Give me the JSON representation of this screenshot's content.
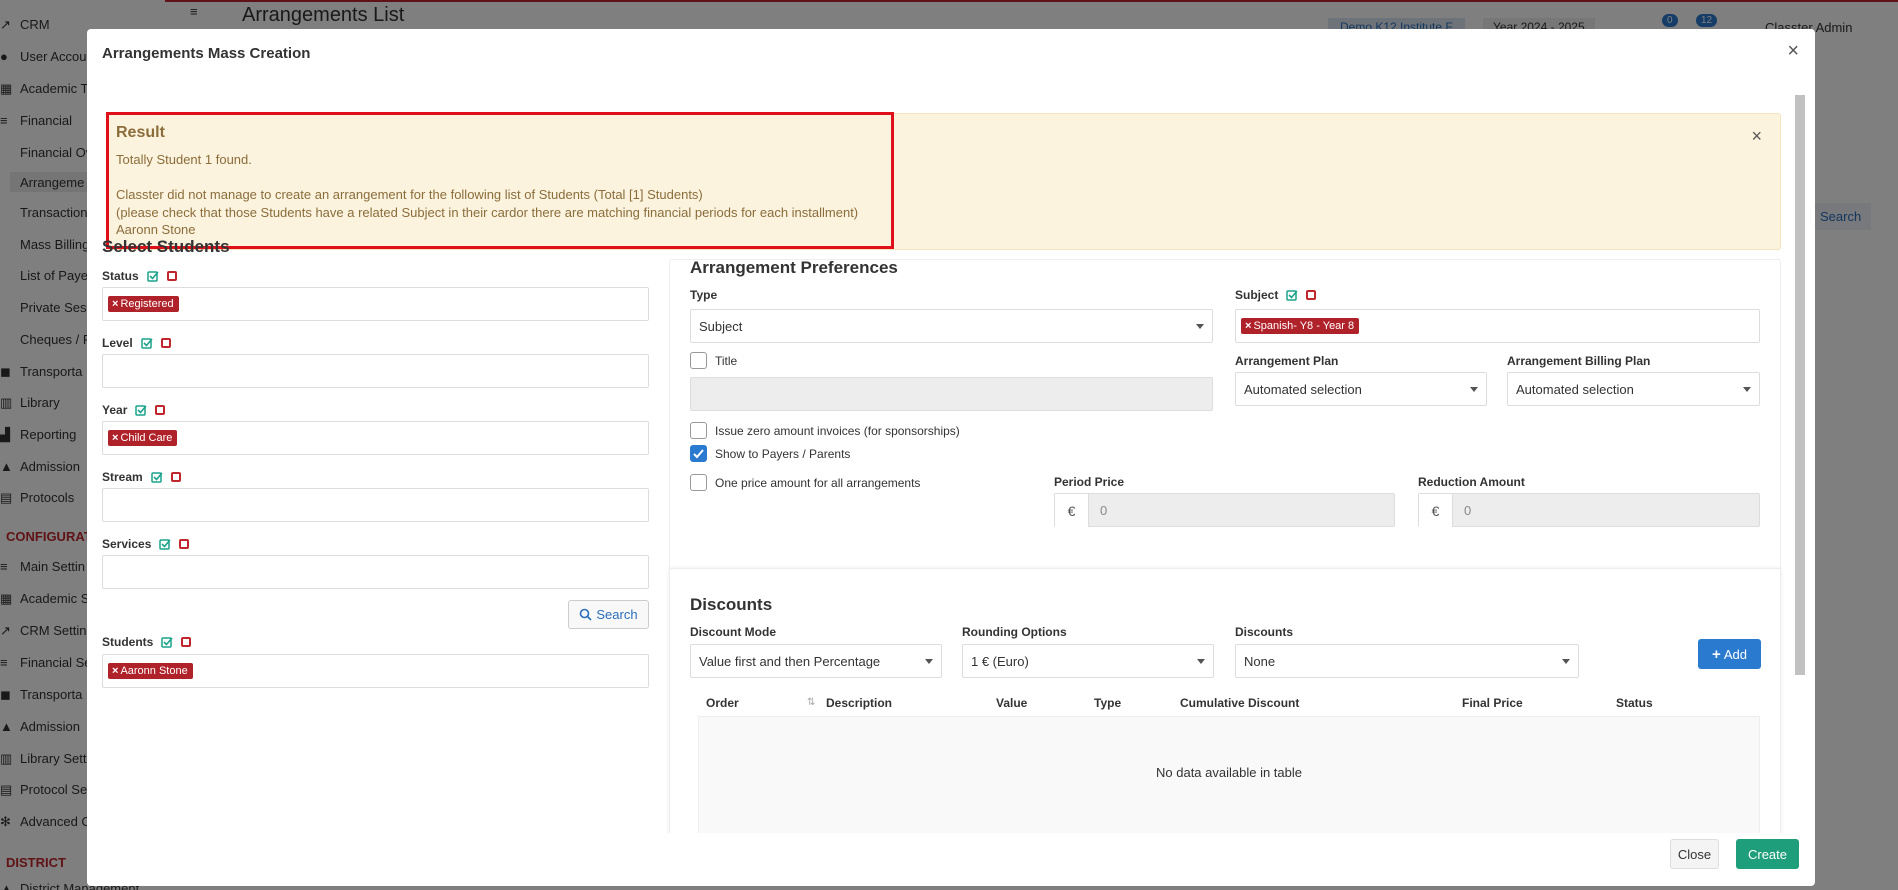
{
  "background": {
    "sidebar": {
      "items": [
        "CRM",
        "User Accou",
        "Academic T",
        "Financial"
      ],
      "financial_sub": [
        "Financial Ov",
        "Arrangeme",
        "Transaction",
        "Mass Billing",
        "List of Payer",
        "Private Sess",
        "Cheques / P"
      ],
      "more_items": [
        "Transporta",
        "Library",
        "Reporting",
        "Admission",
        "Protocols"
      ],
      "config_heading": "CONFIGURATI",
      "config_items": [
        "Main Settin",
        "Academic S",
        "CRM Setting",
        "Financial Se",
        "Transporta",
        "Admission",
        "Library Sett",
        "Protocol Se",
        "Advanced C"
      ],
      "district_heading": "DISTRICT",
      "district_item": "District Management"
    },
    "topbar": {
      "page_title": "Arrangements List",
      "institute": "Demo K12 Institute F",
      "year": "Year 2024 - 2025",
      "notif_count_1": "0",
      "notif_count_2": "12",
      "user": "Classter Admin",
      "search_button": "Search"
    }
  },
  "modal": {
    "title": "Arrangements Mass Creation",
    "result": {
      "heading": "Result",
      "line1": "Totally Student 1 found.",
      "line2": "Classter did not manage to create an arrangement for the following list of Students (Total [1] Students)",
      "line3": "(please check that those Students have a related Subject in their cardor there are matching financial periods for each installment)",
      "line4": "Aaronn Stone"
    },
    "select_students": {
      "title": "Select Students",
      "status_label": "Status",
      "status_tag": "Registered",
      "level_label": "Level",
      "year_label": "Year",
      "year_tag": "Child Care",
      "stream_label": "Stream",
      "services_label": "Services",
      "search_button": "Search",
      "students_label": "Students",
      "students_tag": "Aaronn Stone"
    },
    "preferences": {
      "title": "Arrangement Preferences",
      "type_label": "Type",
      "type_value": "Subject",
      "subject_label": "Subject",
      "subject_tag": "Spanish- Y8 - Year 8",
      "title_checkbox": "Title",
      "plan_label": "Arrangement Plan",
      "plan_value": "Automated selection",
      "billing_label": "Arrangement Billing Plan",
      "billing_value": "Automated selection",
      "zero_invoice": "Issue zero amount invoices (for sponsorships)",
      "show_payers": "Show to Payers / Parents",
      "one_price": "One price amount for all arrangements",
      "period_price_label": "Period Price",
      "period_price_value": "0",
      "reduction_label": "Reduction Amount",
      "reduction_value": "0",
      "currency": "€"
    },
    "discounts": {
      "title": "Discounts",
      "mode_label": "Discount Mode",
      "mode_value": "Value first and then Percentage",
      "rounding_label": "Rounding Options",
      "rounding_value": "1 € (Euro)",
      "discounts_label": "Discounts",
      "discounts_value": "None",
      "add_button": "Add",
      "columns": [
        "Order",
        "Description",
        "Value",
        "Type",
        "Cumulative Discount",
        "Final Price",
        "Status"
      ],
      "empty": "No data available in table"
    },
    "footer": {
      "close": "Close",
      "create": "Create"
    }
  },
  "colors": {
    "brand_red": "#c0262d",
    "tag_red": "#b0222a",
    "primary_blue": "#2a7ad0",
    "create_green": "#1e9e7a",
    "warning_bg": "#fcf3de"
  }
}
